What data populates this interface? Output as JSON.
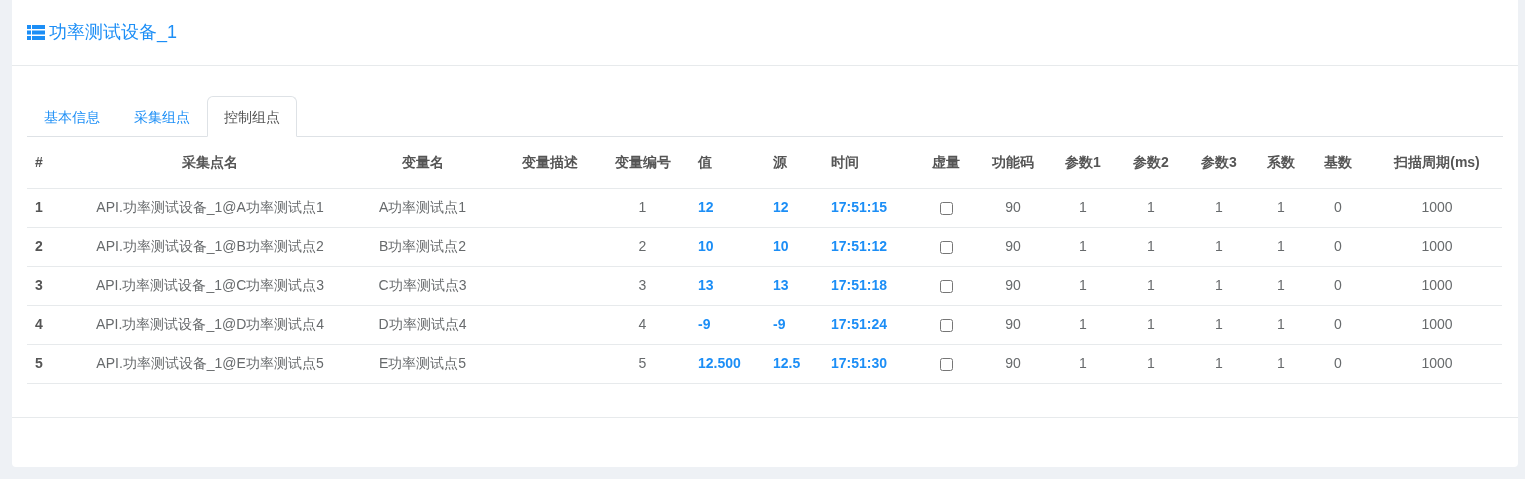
{
  "panel": {
    "title": "功率测试设备_1"
  },
  "tabs": [
    {
      "label": "基本信息",
      "selected": false
    },
    {
      "label": "采集组点",
      "selected": false
    },
    {
      "label": "控制组点",
      "selected": true
    }
  ],
  "table": {
    "columns": [
      "#",
      "采集点名",
      "变量名",
      "变量描述",
      "变量编号",
      "值",
      "源",
      "时间",
      "虚量",
      "功能码",
      "参数1",
      "参数2",
      "参数3",
      "系数",
      "基数",
      "扫描周期(ms)"
    ],
    "rows": [
      {
        "index": "1",
        "point_name": "API.功率测试设备_1@A功率测试点1",
        "var_name": "A功率测试点1",
        "var_no": "1",
        "value": "12",
        "source": "12",
        "time": "17:51:15",
        "virtual": false,
        "func_code": "90",
        "param1": "1",
        "param2": "1",
        "param3": "1",
        "coef": "1",
        "base": "0",
        "scan": "1000"
      },
      {
        "index": "2",
        "point_name": "API.功率测试设备_1@B功率测试点2",
        "var_name": "B功率测试点2",
        "var_no": "2",
        "value": "10",
        "source": "10",
        "time": "17:51:12",
        "virtual": false,
        "func_code": "90",
        "param1": "1",
        "param2": "1",
        "param3": "1",
        "coef": "1",
        "base": "0",
        "scan": "1000"
      },
      {
        "index": "3",
        "point_name": "API.功率测试设备_1@C功率测试点3",
        "var_name": "C功率测试点3",
        "var_no": "3",
        "value": "13",
        "source": "13",
        "time": "17:51:18",
        "virtual": false,
        "func_code": "90",
        "param1": "1",
        "param2": "1",
        "param3": "1",
        "coef": "1",
        "base": "0",
        "scan": "1000"
      },
      {
        "index": "4",
        "point_name": "API.功率测试设备_1@D功率测试点4",
        "var_name": "D功率测试点4",
        "var_no": "4",
        "value": "-9",
        "source": "-9",
        "time": "17:51:24",
        "virtual": false,
        "func_code": "90",
        "param1": "1",
        "param2": "1",
        "param3": "1",
        "coef": "1",
        "base": "0",
        "scan": "1000"
      },
      {
        "index": "5",
        "point_name": "API.功率测试设备_1@E功率测试点5",
        "var_name": "E功率测试点5",
        "var_no": "5",
        "value": "12.500",
        "source": "12.5",
        "time": "17:51:30",
        "virtual": false,
        "func_code": "90",
        "param1": "1",
        "param2": "1",
        "param3": "1",
        "coef": "1",
        "base": "0",
        "scan": "1000"
      }
    ]
  }
}
